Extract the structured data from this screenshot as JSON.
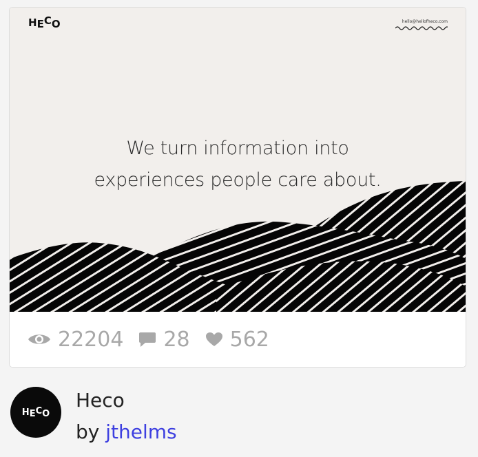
{
  "preview": {
    "brand_letters": [
      "H",
      "E",
      "C",
      "O"
    ],
    "email": "hello@hellofheco.com",
    "headline_line1": "We turn information into",
    "headline_line2": "experiences people care about."
  },
  "stats": {
    "views": "22204",
    "comments": "28",
    "likes": "562"
  },
  "author": {
    "avatar_letters": [
      "H",
      "E",
      "C",
      "O"
    ],
    "shot_title": "Heco",
    "by_prefix": "by",
    "username": "jthelms"
  },
  "icons": {
    "views": "eye-icon",
    "comments": "comment-icon",
    "likes": "heart-icon"
  },
  "colors": {
    "stat_text": "#a8a8a8",
    "username_link": "#3d3fe0",
    "preview_bg": "#f2efec",
    "avatar_bg": "#0a0a0a"
  }
}
